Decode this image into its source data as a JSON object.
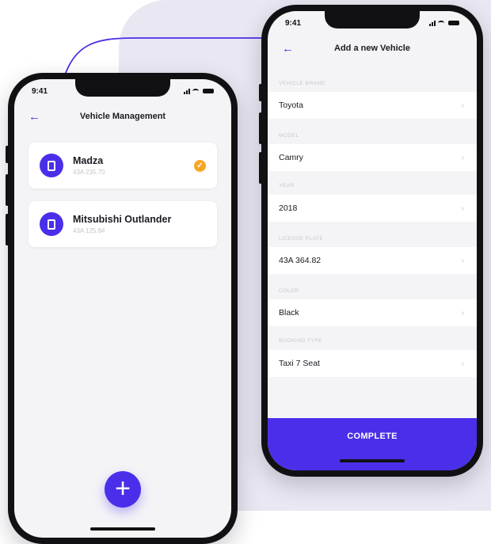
{
  "colors": {
    "accent": "#4a2fea",
    "check": "#f5a623",
    "background_panel": "#e9e8f2"
  },
  "icons": {
    "back": "arrow-left-icon",
    "vehicle": "document-icon",
    "selected": "check-circle-icon",
    "add": "plus-icon",
    "chevron": "chevron-right-icon"
  },
  "left_phone": {
    "status_time": "9:41",
    "title": "Vehicle Management",
    "vehicles": [
      {
        "name": "Madza",
        "plate": "43A 235.70",
        "selected": true
      },
      {
        "name": "Mitsubishi Outlander",
        "plate": "43A 125.84",
        "selected": false
      }
    ],
    "add_button": "+"
  },
  "right_phone": {
    "status_time": "9:41",
    "title": "Add a new Vehicle",
    "fields": [
      {
        "label": "VEHICLE BRAND",
        "value": "Toyota"
      },
      {
        "label": "MODEL",
        "value": "Camry"
      },
      {
        "label": "YEAR",
        "value": "2018"
      },
      {
        "label": "LICENSE PLATE",
        "value": "43A 364.82"
      },
      {
        "label": "COLOR",
        "value": "Black"
      },
      {
        "label": "BOOKING TYPE",
        "value": "Taxi 7 Seat"
      }
    ],
    "complete_label": "COMPLETE"
  }
}
